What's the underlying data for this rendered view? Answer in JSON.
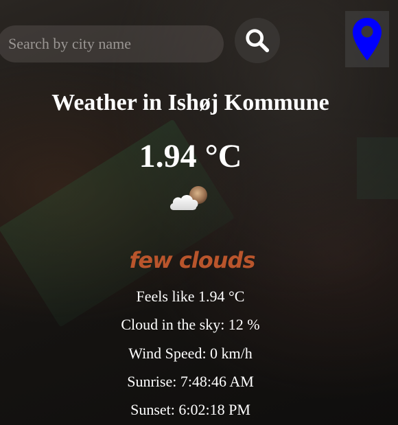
{
  "search": {
    "placeholder": "Search by city name",
    "value": ""
  },
  "icons": {
    "search": "search-icon",
    "location": "map-pin-icon",
    "weather": "few-clouds-icon"
  },
  "colors": {
    "location_pin": "#0000ff",
    "description": "#b9552c"
  },
  "weather": {
    "title": "Weather in Ishøj Kommune",
    "temperature": "1.94 °C",
    "description": "few clouds",
    "details": {
      "feels_like": "Feels like 1.94 °C",
      "cloud": "Cloud in the sky: 12 %",
      "wind": "Wind Speed: 0 km/h",
      "sunrise": "Sunrise: 7:48:46 AM",
      "sunset": "Sunset: 6:02:18 PM"
    }
  }
}
